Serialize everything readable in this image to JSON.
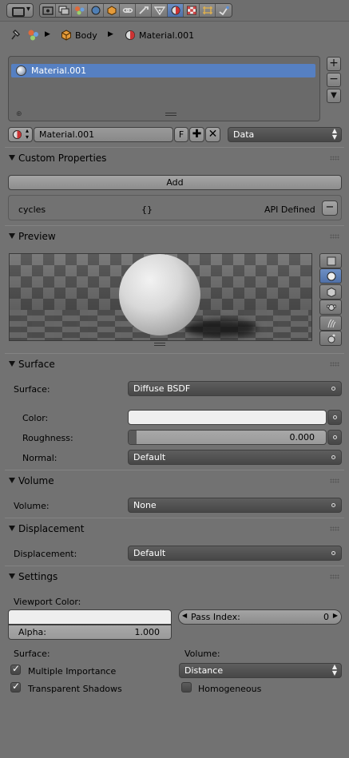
{
  "header": {
    "tabs": [
      "render",
      "render-layers",
      "scene",
      "world",
      "object",
      "constraints",
      "modifiers",
      "data",
      "material",
      "texture",
      "particles",
      "physics"
    ],
    "active_tab": "material"
  },
  "breadcrumb": {
    "object": "Body",
    "material": "Material.001"
  },
  "material_list": {
    "items": [
      "Material.001"
    ],
    "selected_index": 0
  },
  "material_slot": {
    "name": "Material.001",
    "fake_user": "F",
    "link": "Data"
  },
  "custom_properties": {
    "title": "Custom Properties",
    "add_label": "Add",
    "prop_name": "cycles",
    "prop_value": "{}",
    "prop_source": "API Defined"
  },
  "preview": {
    "title": "Preview",
    "shape": "sphere"
  },
  "surface": {
    "title": "Surface",
    "surface_label": "Surface:",
    "surface_value": "Diffuse BSDF",
    "color_label": "Color:",
    "color_value": "#eeeeee",
    "roughness_label": "Roughness:",
    "roughness_value": "0.000",
    "normal_label": "Normal:",
    "normal_value": "Default"
  },
  "volume": {
    "title": "Volume",
    "label": "Volume:",
    "value": "None"
  },
  "displacement": {
    "title": "Displacement",
    "label": "Displacement:",
    "value": "Default"
  },
  "settings": {
    "title": "Settings",
    "viewport_color_label": "Viewport Color:",
    "viewport_color": "#eeeeee",
    "pass_index_label": "Pass Index:",
    "pass_index_value": "0",
    "alpha_label": "Alpha:",
    "alpha_value": "1.000",
    "surface_label": "Surface:",
    "volume_label": "Volume:",
    "multiple_importance_label": "Multiple Importance",
    "multiple_importance": true,
    "transparent_shadows_label": "Transparent Shadows",
    "transparent_shadows": true,
    "volume_sampling": "Distance",
    "homogeneous_label": "Homogeneous",
    "homogeneous": false
  },
  "colors": {
    "selection": "#5680c2",
    "active_tab": "#5b7db8",
    "background": "#727272"
  }
}
